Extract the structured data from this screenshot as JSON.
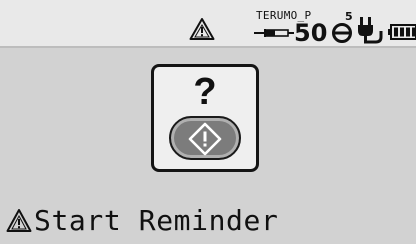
{
  "status_bar": {
    "alert_icon": "warning-triangle-icon",
    "syringe_brand": "TERUMO_P",
    "syringe_size": "50",
    "occlusion_level": "5",
    "icons": [
      "syringe-icon",
      "pressure-sensor-icon",
      "ac-power-plug-icon",
      "battery-icon"
    ]
  },
  "dialog": {
    "symbol": "?",
    "button_icon": "start-diamond-icon"
  },
  "footer": {
    "icon": "warning-triangle-icon",
    "message": "Start Reminder"
  }
}
